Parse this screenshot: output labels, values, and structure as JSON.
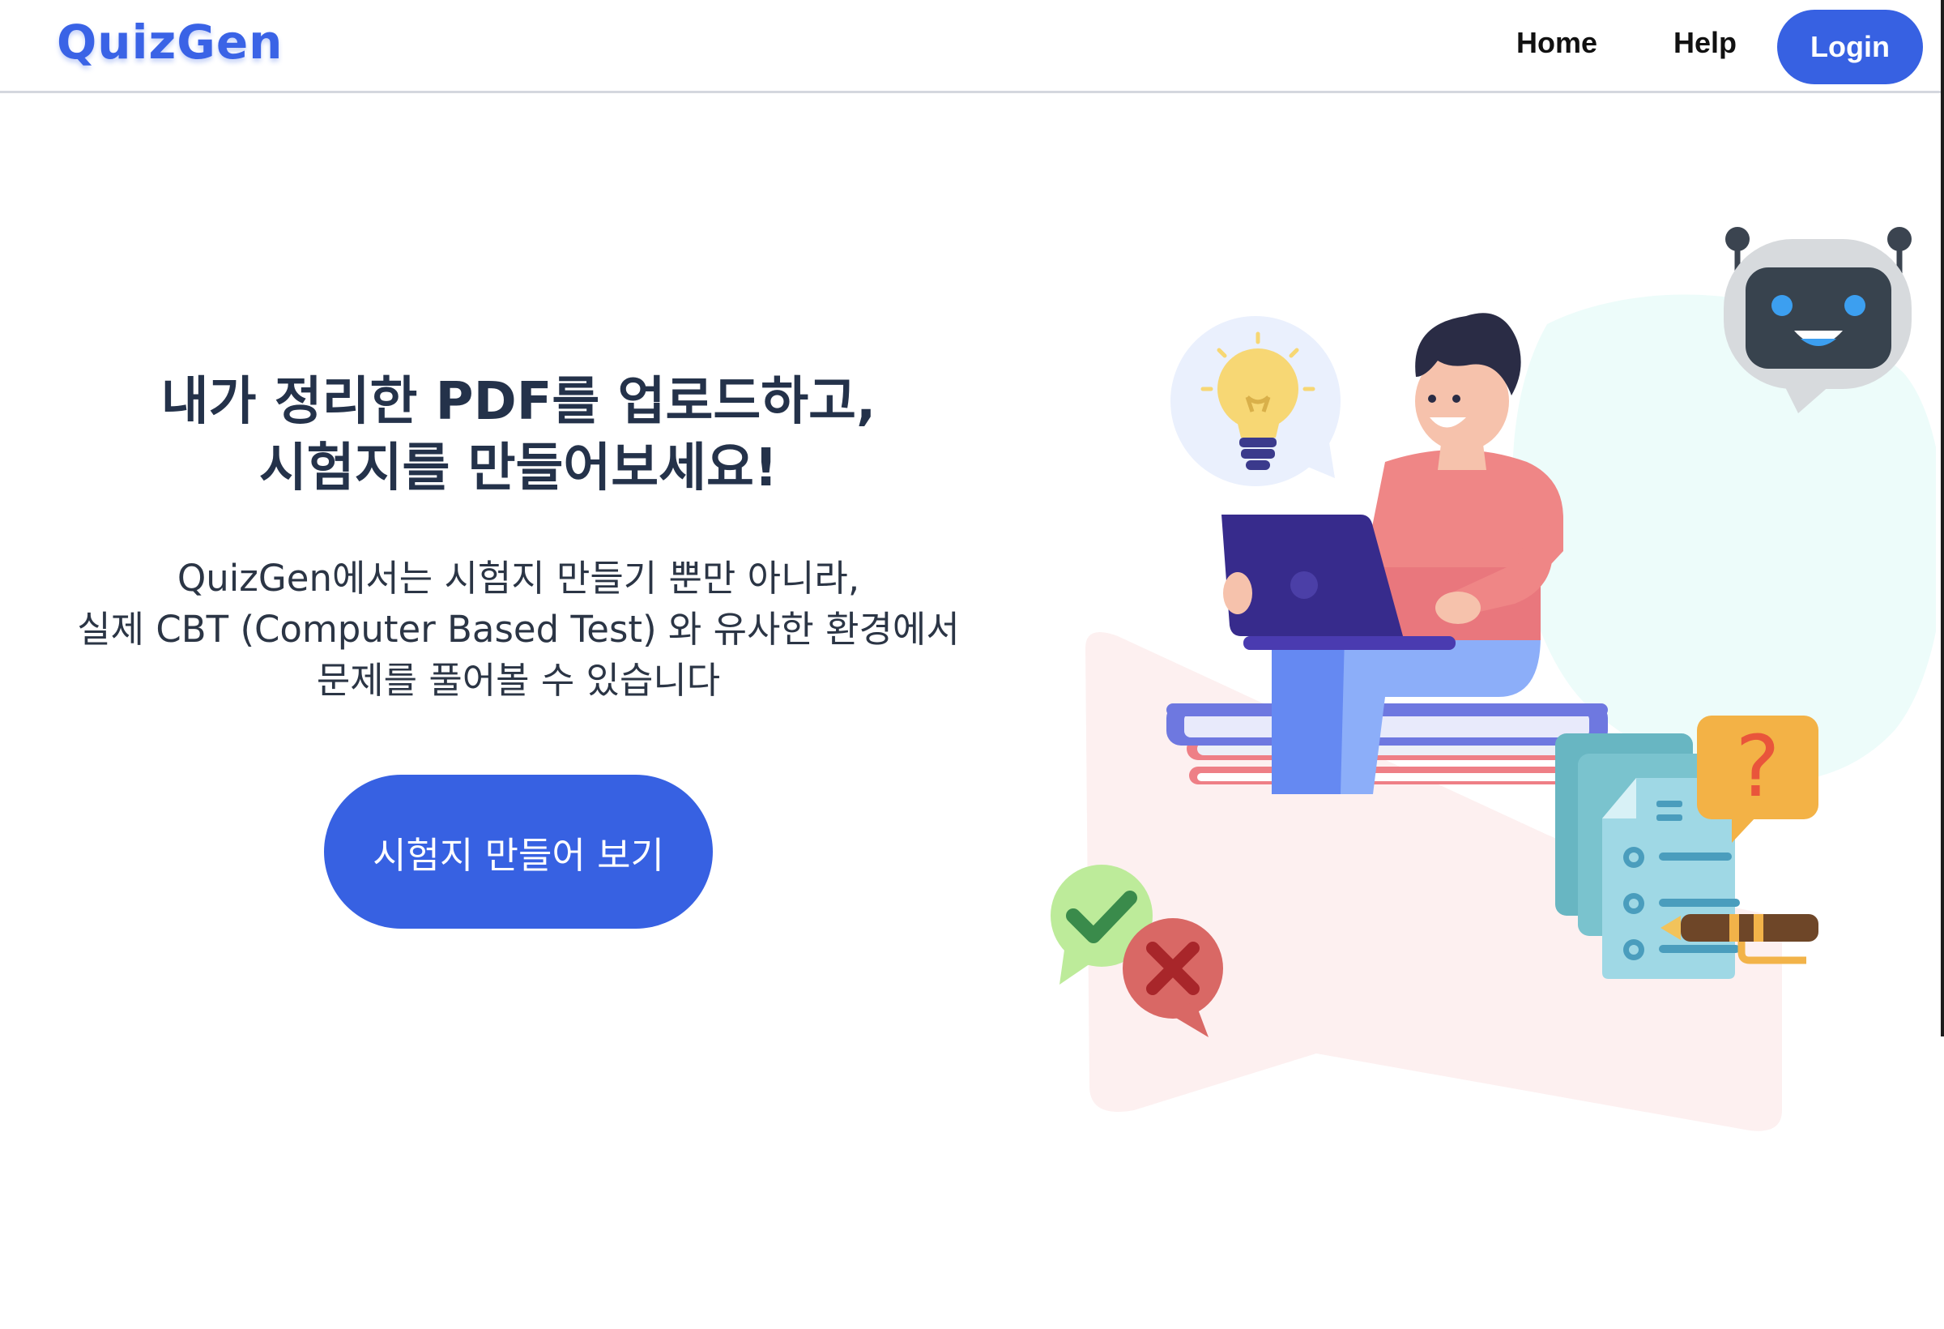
{
  "header": {
    "logo": "QuizGen",
    "nav": {
      "home": "Home",
      "help": "Help",
      "login": "Login"
    }
  },
  "hero": {
    "title_line1": "내가 정리한 PDF를 업로드하고,",
    "title_line2": "시험지를 만들어보세요!",
    "desc_line1": "QuizGen에서는 시험지 만들기 뿐만 아니라,",
    "desc_line2": "실제 CBT (Computer Based Test) 와 유사한 환경에서",
    "desc_line3": "문제를 풀어볼 수 있습니다",
    "cta": "시험지 만들어 보기"
  },
  "illustration": {
    "question_mark": "?"
  },
  "colors": {
    "brand": "#3761e2",
    "title": "#24324a",
    "text": "#2b3545"
  },
  "icons": [
    "robot-icon",
    "lightbulb-icon",
    "checkmark-icon",
    "cross-icon",
    "question-icon",
    "pen-icon",
    "document-icon",
    "laptop-icon"
  ]
}
